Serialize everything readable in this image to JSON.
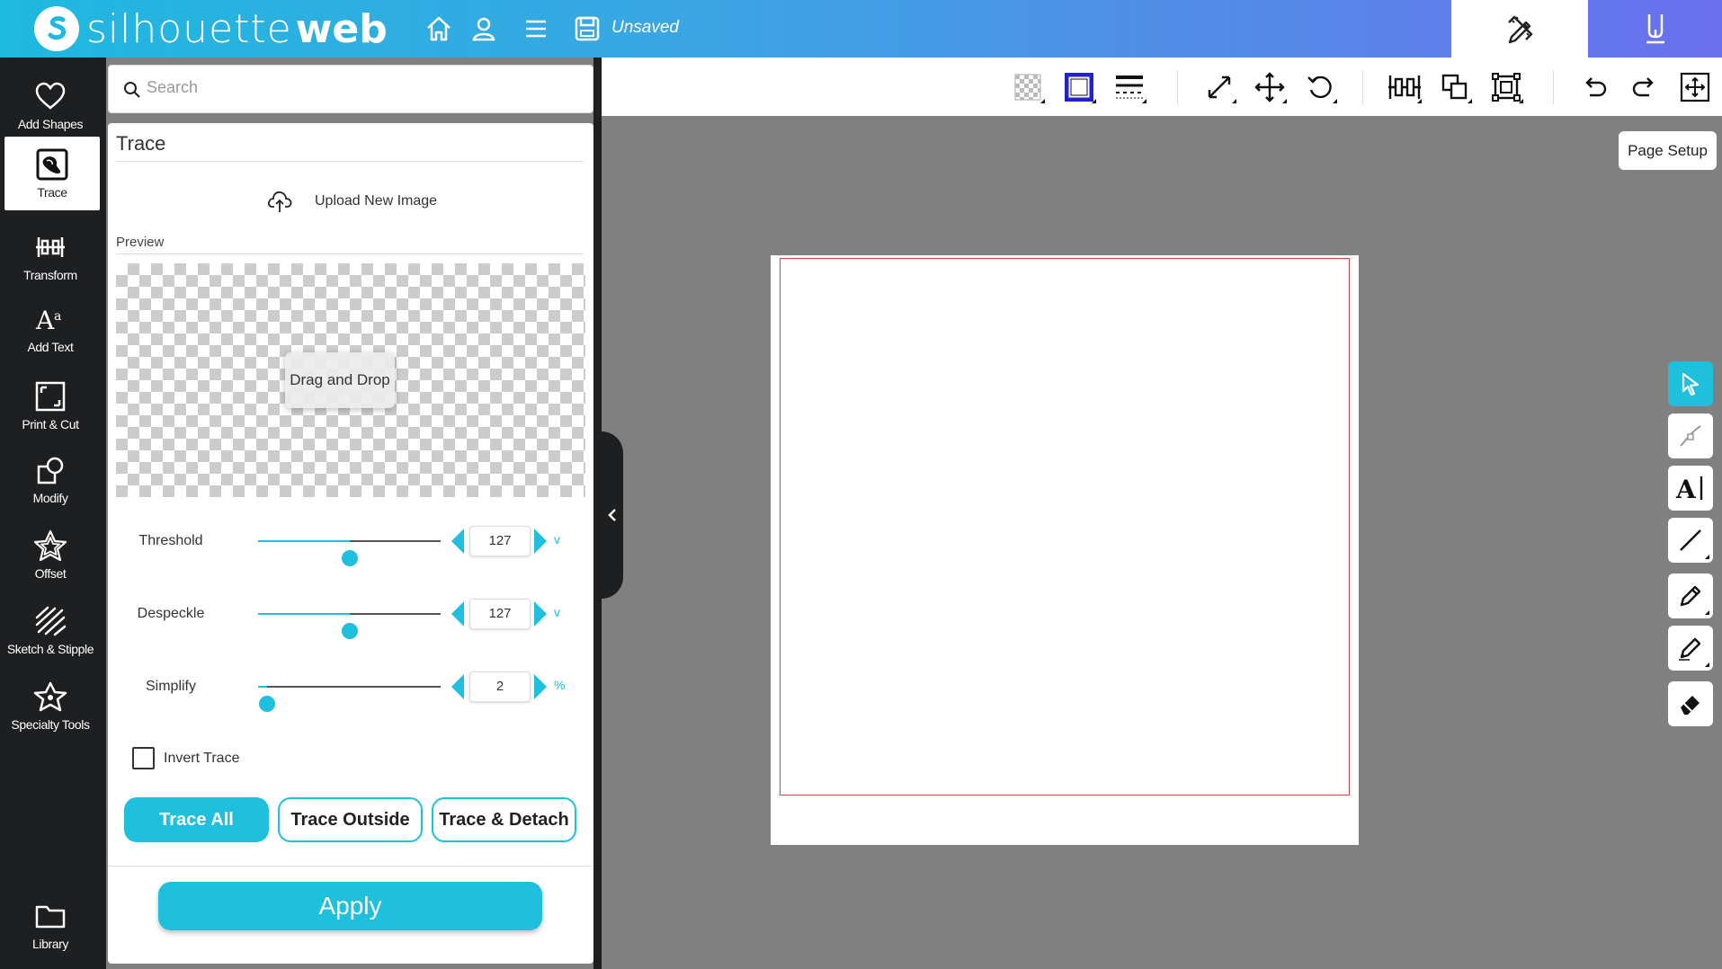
{
  "app": {
    "logo_text_light": "silhouette",
    "logo_text_bold": "web",
    "file_status": "Unsaved",
    "brand_color": "#1fc0dd"
  },
  "topbar": {
    "icons": [
      "home-icon",
      "user-icon",
      "menu-icon",
      "save-icon"
    ],
    "modes": [
      "design-mode-icon",
      "send-mode-icon"
    ]
  },
  "leftnav": {
    "items": [
      {
        "label": "Add Shapes",
        "icon": "heart-icon"
      },
      {
        "label": "Trace",
        "icon": "trace-icon",
        "active": true
      },
      {
        "label": "Transform",
        "icon": "transform-icon"
      },
      {
        "label": "Add Text",
        "icon": "text-icon"
      },
      {
        "label": "Print & Cut",
        "icon": "registration-marks-icon"
      },
      {
        "label": "Modify",
        "icon": "modify-icon"
      },
      {
        "label": "Offset",
        "icon": "offset-star-icon"
      },
      {
        "label": "Sketch & Stipple",
        "icon": "sketch-icon"
      },
      {
        "label": "Specialty Tools",
        "icon": "specialty-star-icon"
      }
    ],
    "library_label": "Library"
  },
  "search": {
    "placeholder": "Search"
  },
  "panel": {
    "title": "Trace",
    "upload_label": "Upload New Image",
    "preview_label": "Preview",
    "dragdrop_label": "Drag and Drop",
    "sliders": [
      {
        "label": "Threshold",
        "value": "127",
        "unit": "v",
        "fraction": 0.5
      },
      {
        "label": "Despeckle",
        "value": "127",
        "unit": "v",
        "fraction": 0.5
      },
      {
        "label": "Simplify",
        "value": "2",
        "unit": "%",
        "fraction": 0.05
      }
    ],
    "invert_label": "Invert Trace",
    "invert_checked": false,
    "trace_buttons": [
      "Trace All",
      "Trace Outside",
      "Trace & Detach"
    ],
    "apply_label": "Apply"
  },
  "toolbar": {
    "icons": [
      "fill-pattern-icon",
      "line-color-icon",
      "line-style-icon",
      "scale-icon",
      "move-icon",
      "rotate-icon",
      "align-icon",
      "replicate-icon",
      "group-icon",
      "undo-icon",
      "redo-icon",
      "zoom-fit-icon"
    ]
  },
  "page_setup_label": "Page Setup",
  "right_tools": [
    "select-tool-icon",
    "point-edit-tool-icon",
    "text-tool-icon",
    "line-tool-icon",
    "pen-tool-icon",
    "pencil-tool-icon",
    "eraser-tool-icon"
  ]
}
